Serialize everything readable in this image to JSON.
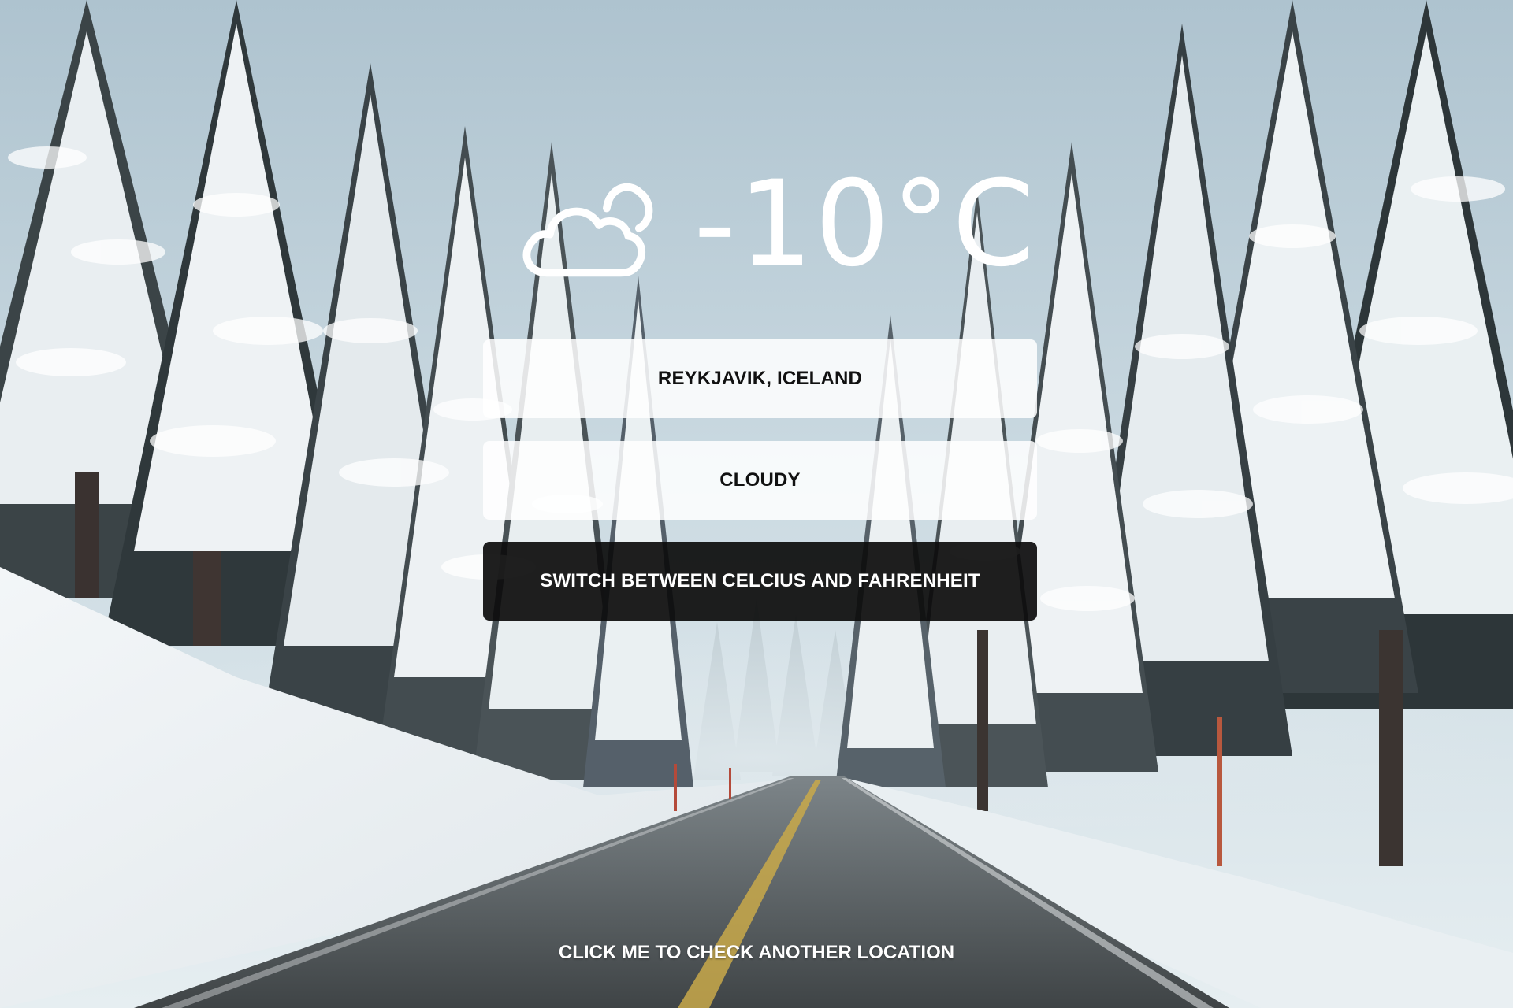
{
  "weather": {
    "icon": "cloud-icon",
    "temperature": "-10°C"
  },
  "location": "REYKJAVIK, ICELAND",
  "condition": "CLOUDY",
  "toggle_button": "SWITCH BETWEEN CELCIUS AND FAHRENHEIT",
  "check_location_link": "CLICK ME TO CHECK ANOTHER LOCATION",
  "colors": {
    "panel_light": "#ffffff",
    "panel_dark": "#0c0c0c",
    "text_light": "#ffffff",
    "text_dark": "#111111"
  }
}
